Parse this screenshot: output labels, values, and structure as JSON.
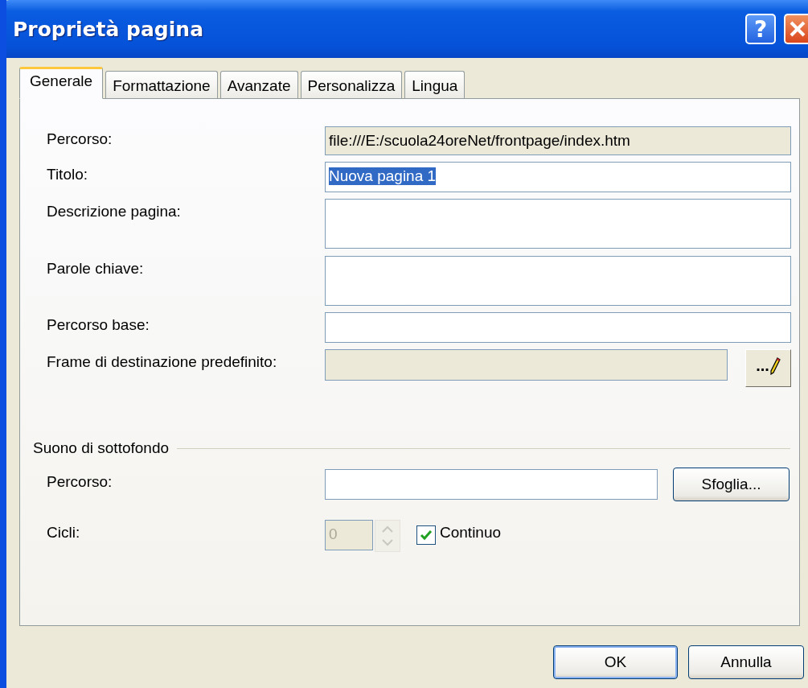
{
  "window": {
    "title": "Proprietà pagina",
    "help": "?"
  },
  "tabs": [
    {
      "label": "Generale",
      "selected": true
    },
    {
      "label": "Formattazione",
      "selected": false
    },
    {
      "label": "Avanzate",
      "selected": false
    },
    {
      "label": "Personalizza",
      "selected": false
    },
    {
      "label": "Lingua",
      "selected": false
    }
  ],
  "fields": [
    {
      "kind": "readonly",
      "label": "Percorso:",
      "value": "file:///E:/scuola24oreNet/frontpage/index.htm"
    },
    {
      "kind": "text",
      "label": "Titolo:",
      "value": "Nuova pagina 1",
      "highlighted": true
    },
    {
      "kind": "multiline",
      "label": "Descrizione pagina:"
    },
    {
      "kind": "multiline",
      "label": "Parole chiave:"
    },
    {
      "kind": "text",
      "label": "Percorso base:"
    },
    {
      "kind": "disabled",
      "label": "Frame di destinazione predefinito:",
      "button": "..."
    }
  ],
  "sound": {
    "title": "Suono di sottofondo",
    "path_label": "Percorso:",
    "browse_button": "Sfoglia...",
    "loops_label": "Cicli:",
    "loops_value": "0",
    "loops_disabled": true,
    "continuous": {
      "label": "Continuo",
      "checked": true
    }
  },
  "buttons": [
    {
      "label": "OK",
      "default": true
    },
    {
      "label": "Annulla",
      "default": false
    }
  ]
}
